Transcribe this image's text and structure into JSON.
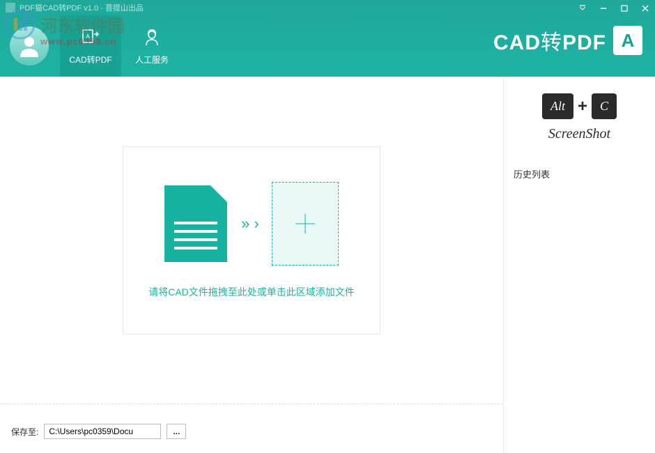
{
  "window": {
    "title": "PDF猫CAD转PDF v1.0 - 菩提山出品"
  },
  "watermark": {
    "text": "河东软件园",
    "url": "www.pc0359.cn"
  },
  "nav": {
    "items": [
      {
        "label": "CAD转PDF"
      },
      {
        "label": "人工服务"
      }
    ]
  },
  "brand": {
    "text_en1": "CAD",
    "text_cn": "转",
    "text_en2": "PDF",
    "badge": "A"
  },
  "drop": {
    "hint": "请将CAD文件拖拽至此处或单击此区域添加文件"
  },
  "footer": {
    "save_label": "保存至:",
    "path": "C:\\Users\\pc0359\\Docu",
    "browse": "..."
  },
  "promo": {
    "key1": "Alt",
    "plus": "+",
    "key2": "C",
    "label": "ScreenShot"
  },
  "history": {
    "title": "历史列表"
  }
}
